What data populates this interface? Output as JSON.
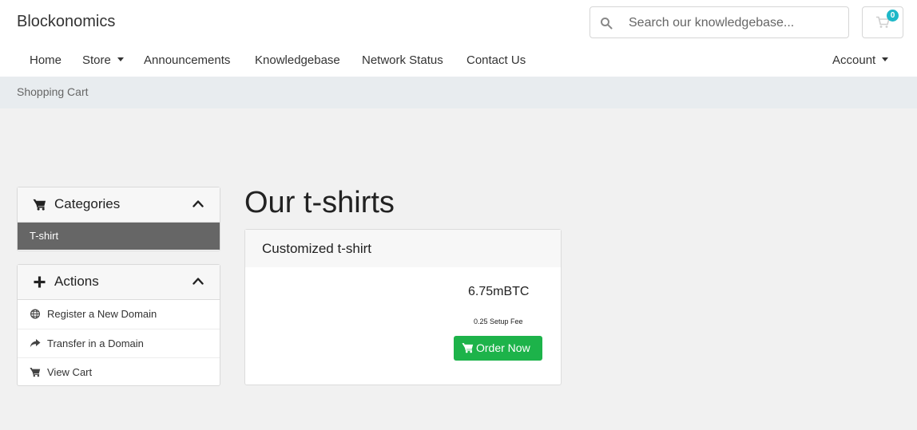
{
  "header": {
    "brand": "Blockonomics",
    "search": {
      "placeholder": "Search our knowledgebase..."
    },
    "cart": {
      "count": "0"
    }
  },
  "nav": {
    "items": [
      "Home",
      "Store",
      "Announcements",
      "Knowledgebase",
      "Network Status",
      "Contact Us"
    ],
    "account": "Account"
  },
  "breadcrumb": "Shopping Cart",
  "sidebar": {
    "categories": {
      "title": "Categories",
      "items": [
        "T-shirt"
      ]
    },
    "actions": {
      "title": "Actions",
      "items": [
        "Register a New Domain",
        "Transfer in a Domain",
        "View Cart"
      ]
    }
  },
  "main": {
    "title": "Our t-shirts",
    "product": {
      "name": "Customized t-shirt",
      "price": "6.75mBTC",
      "setup_fee": "0.25 Setup Fee",
      "order_label": "Order Now"
    }
  },
  "colors": {
    "order_button": "#1db34a",
    "cart_badge": "#1fb8c8",
    "active_category": "#666666",
    "breadcrumb_bar": "#e8ecef"
  },
  "icons": {
    "search": "search-icon",
    "cart": "cart-icon",
    "categories": "cart-icon",
    "actions": "plus-icon",
    "collapse": "chevron-up-icon",
    "register": "globe-icon",
    "transfer": "share-arrow-icon",
    "view_cart": "cart-icon"
  }
}
